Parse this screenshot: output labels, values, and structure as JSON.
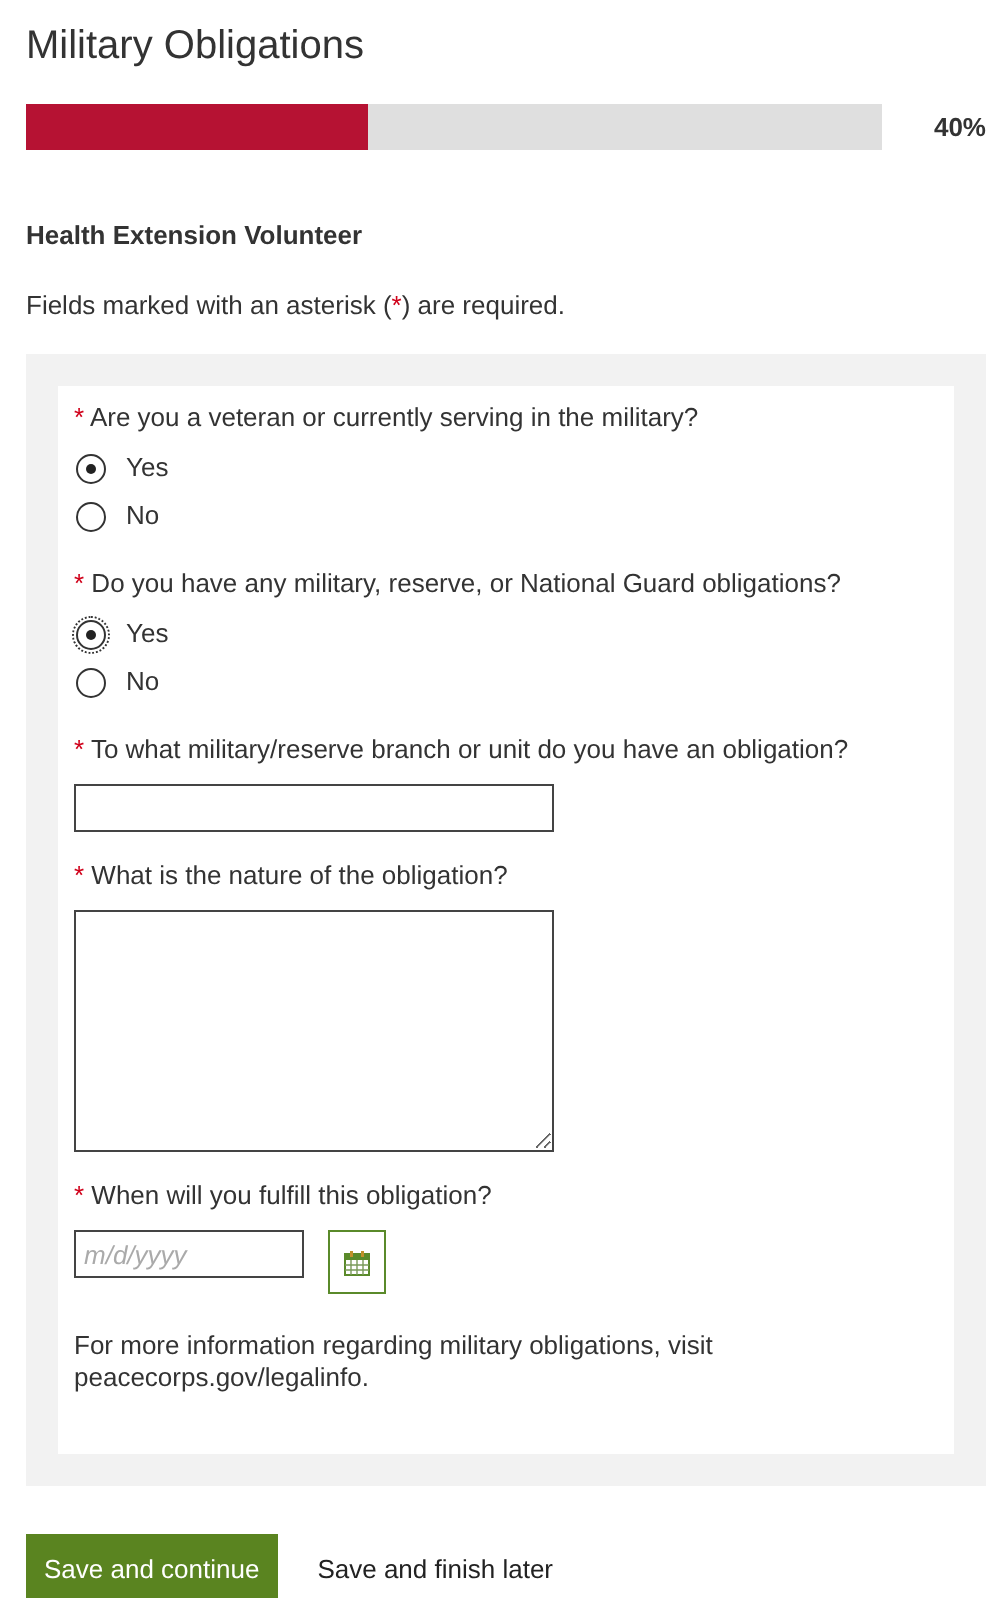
{
  "title": "Military Obligations",
  "progress": {
    "level": 0.4,
    "reading": "40%"
  },
  "subtitle": "Health Extension Volunteer",
  "note": {
    "before": "Fields marked with an asterisk (",
    "mark": "*",
    "after": ") are required."
  },
  "questions": [
    {
      "kind": "radio",
      "required_mark": "*",
      "label": "Are you a veteran or currently serving in the military?",
      "options": [
        {
          "label": "Yes",
          "selected": true,
          "focused": false
        },
        {
          "label": "No",
          "selected": false,
          "focused": false
        }
      ]
    },
    {
      "kind": "radio",
      "required_mark": "*",
      "label": "Do you have any military, reserve, or National Guard obligations?",
      "options": [
        {
          "label": "Yes",
          "selected": true,
          "focused": true
        },
        {
          "label": "No",
          "selected": false,
          "focused": false
        }
      ]
    },
    {
      "kind": "text",
      "required_mark": "*",
      "label": "To what military/reserve branch or unit do you have an obligation?"
    },
    {
      "kind": "textarea",
      "required_mark": "*",
      "label": "What is the nature of the obligation?"
    },
    {
      "kind": "date",
      "required_mark": "*",
      "label": "When will you fulfill this obligation?",
      "placeholder": "m/d/yyyy"
    }
  ],
  "info": "For more information regarding military obligations, visit peacecorps.gov/legalinfo.",
  "buttons": [
    {
      "kind": "primary",
      "label": "Save and continue"
    },
    {
      "kind": "link",
      "label": "Save and finish later"
    }
  ]
}
